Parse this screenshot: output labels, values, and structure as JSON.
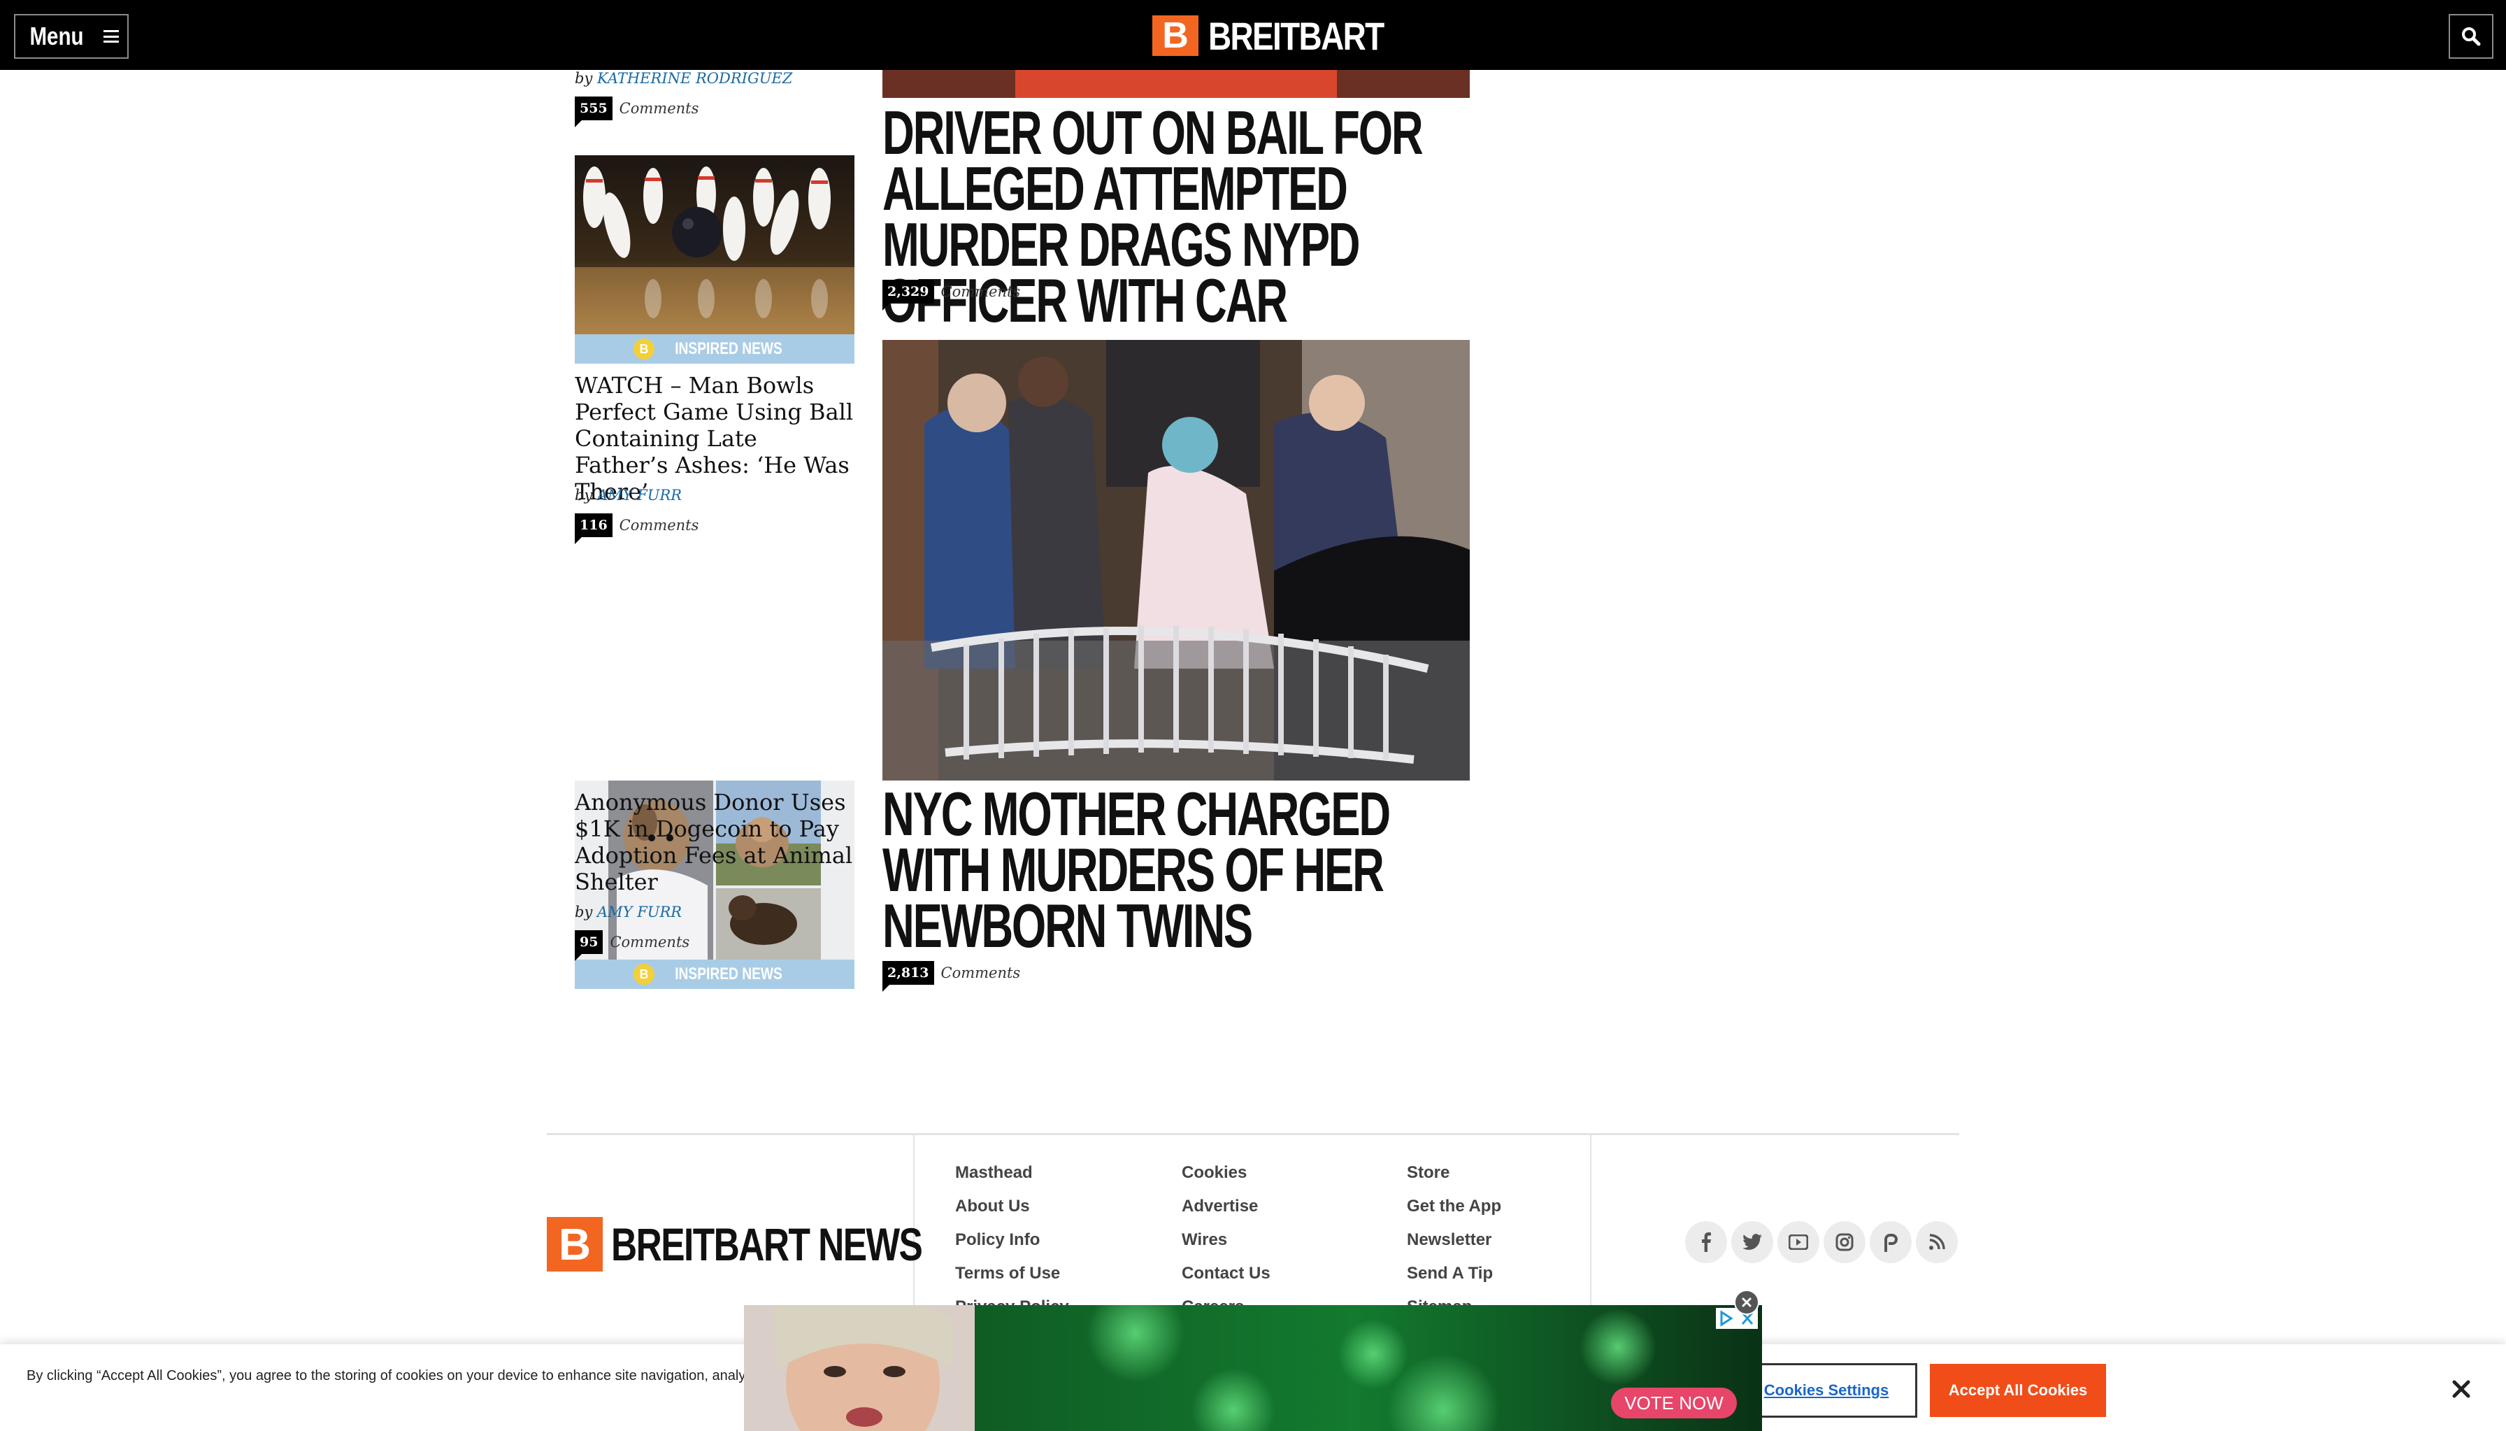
{
  "nav": {
    "menu_label": "Menu",
    "brand": "BREITBART",
    "brand_letter": "B",
    "search_icon": "search-icon"
  },
  "sidebar": {
    "top_fragment": {
      "by": "by",
      "author": "KATHERINE RODRIGUEZ",
      "comment_count": "555",
      "comment_label": "Comments"
    },
    "articles": [
      {
        "image": "bowling-pins-photo",
        "badge_letter": "B",
        "badge": "INSPIRED NEWS",
        "title": "WATCH – Man Bowls Perfect Game Using Ball Containing Late Father’s Ashes: ‘He Was There’",
        "by": "by",
        "author": "AMY FURR",
        "comment_count": "116",
        "comment_label": "Comments"
      },
      {
        "image": "dogs-collage-photo",
        "badge_letter": "B",
        "badge": "INSPIRED NEWS",
        "title": "Anonymous Donor Uses $1K in Dogecoin to Pay Adoption Fees at Animal Shelter",
        "by": "by",
        "author": "AMY FURR",
        "comment_count": "95",
        "comment_label": "Comments"
      }
    ]
  },
  "main": {
    "articles": [
      {
        "headline": "DRIVER OUT ON BAIL FOR ALLEGED ATTEMPTED MURDER DRAGS NYPD OFFICER WITH CAR",
        "comment_count": "2,329",
        "comment_label": "Comments"
      },
      {
        "image": "arrest-photo",
        "headline": "NYC MOTHER CHARGED WITH MURDERS OF HER NEWBORN TWINS",
        "comment_count": "2,813",
        "comment_label": "Comments"
      }
    ]
  },
  "footer": {
    "brand": "BREITBART NEWS",
    "brand_letter": "B",
    "col1": [
      "Masthead",
      "About Us",
      "Policy Info",
      "Terms of Use",
      "Privacy Policy"
    ],
    "col2": [
      "Cookies",
      "Advertise",
      "Wires",
      "Contact Us",
      "Careers"
    ],
    "col3": [
      "Store",
      "Get the App",
      "Newsletter",
      "Send A Tip",
      "Sitemap"
    ],
    "social_icons": [
      "facebook-icon",
      "twitter-icon",
      "youtube-icon",
      "instagram-icon",
      "parler-icon",
      "rss-icon"
    ]
  },
  "cookie_banner": {
    "text": "By clicking “Accept All Cookies”, you agree to the storing of cookies on your device to enhance site navigation, analyze site usage, and assist in our marketing efforts.",
    "settings_label": "Cookies Settings",
    "accept_label": "Accept All Cookies"
  },
  "ad": {
    "cta": "VOTE NOW"
  },
  "colors": {
    "brand_orange": "#f26622",
    "link_blue": "#1a6aa4",
    "accept_orange": "#f14d19",
    "inspired_blue": "#a9cce6",
    "ad_pink": "#e8456a"
  }
}
